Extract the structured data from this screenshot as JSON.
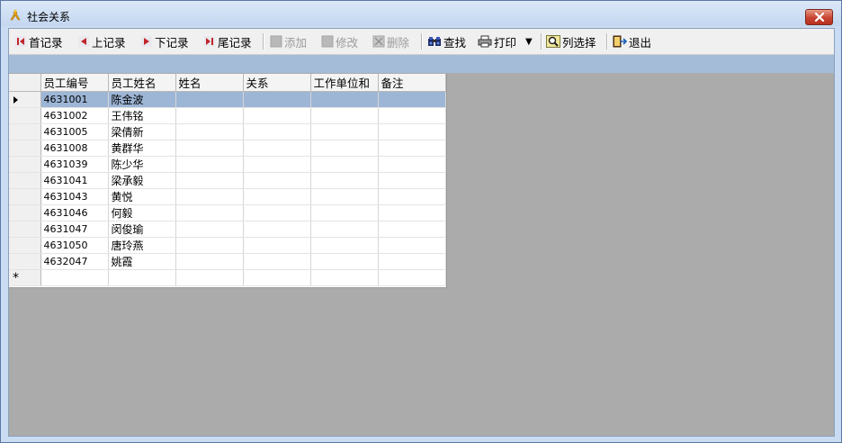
{
  "window": {
    "title": "社会关系",
    "close_label": "✕"
  },
  "toolbar": {
    "items": [
      {
        "label": "首记录",
        "icon": "first-record-icon",
        "enabled": true
      },
      {
        "label": "上记录",
        "icon": "prev-record-icon",
        "enabled": true
      },
      {
        "label": "下记录",
        "icon": "next-record-icon",
        "enabled": true
      },
      {
        "label": "尾记录",
        "icon": "last-record-icon",
        "enabled": true
      },
      {
        "label": "添加",
        "icon": "add-icon",
        "enabled": false
      },
      {
        "label": "修改",
        "icon": "edit-icon",
        "enabled": false
      },
      {
        "label": "删除",
        "icon": "delete-icon",
        "enabled": false
      },
      {
        "label": "查找",
        "icon": "binoculars-icon",
        "enabled": true
      },
      {
        "label": "打印",
        "icon": "printer-icon",
        "enabled": true
      },
      {
        "label": "列选择",
        "icon": "magnifier-icon",
        "enabled": true
      },
      {
        "label": "退出",
        "icon": "exit-door-icon",
        "enabled": true
      }
    ],
    "print_dropdown": "▼"
  },
  "grid": {
    "columns": [
      "员工编号",
      "员工姓名",
      "姓名",
      "关系",
      "工作单位和",
      "备注"
    ],
    "rows": [
      [
        "4631001",
        "陈金波",
        "",
        "",
        "",
        ""
      ],
      [
        "4631002",
        "王伟铭",
        "",
        "",
        "",
        ""
      ],
      [
        "4631005",
        "梁倩新",
        "",
        "",
        "",
        ""
      ],
      [
        "4631008",
        "黄群华",
        "",
        "",
        "",
        ""
      ],
      [
        "4631039",
        "陈少华",
        "",
        "",
        "",
        ""
      ],
      [
        "4631041",
        "梁承毅",
        "",
        "",
        "",
        ""
      ],
      [
        "4631043",
        "黄悦",
        "",
        "",
        "",
        ""
      ],
      [
        "4631046",
        "何毅",
        "",
        "",
        "",
        ""
      ],
      [
        "4631047",
        "闵俊瑜",
        "",
        "",
        "",
        ""
      ],
      [
        "4631050",
        "唐玲燕",
        "",
        "",
        "",
        ""
      ],
      [
        "4632047",
        "姚霞",
        "",
        "",
        "",
        ""
      ]
    ],
    "selected_row": 0,
    "new_row_marker": "*"
  }
}
